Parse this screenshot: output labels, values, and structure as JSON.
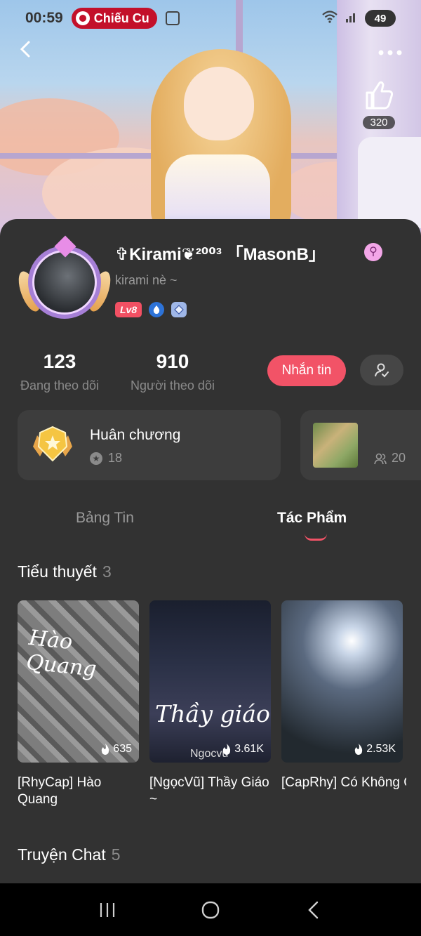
{
  "status_bar": {
    "time": "00:59",
    "live_label": "Chiếu Cu",
    "battery": "49"
  },
  "header": {
    "like_count": "320"
  },
  "profile": {
    "username": "✞Kirami❦²⁰⁰³ 「MasonB」",
    "bio": "kirami nè ~",
    "level": "Lv8",
    "gender_symbol": "⚲"
  },
  "stats": {
    "following_count": "123",
    "following_label": "Đang theo dõi",
    "followers_count": "910",
    "followers_label": "Người theo dõi"
  },
  "actions": {
    "message_label": "Nhắn tin"
  },
  "medals": {
    "title": "Huân chương",
    "count": "18"
  },
  "group": {
    "members": "20"
  },
  "tabs": [
    {
      "label": "Bảng Tin"
    },
    {
      "label": "Tác Phẩm"
    }
  ],
  "sections": {
    "novels": {
      "label": "Tiểu thuyết",
      "count": "3"
    },
    "chat_stories": {
      "label": "Truyện Chat",
      "count": "5"
    }
  },
  "novels": [
    {
      "title": "[RhyCap] Hào Quang",
      "views": "635",
      "cover_text": "Hào Quang"
    },
    {
      "title": "[NgọcVũ] Thầy Giáo ~",
      "views": "3.61K",
      "cover_text": "Thầy giáo",
      "cover_author": "Ngocvu"
    },
    {
      "title": "[CapRhy] Có Không Giữ... Mất Lại Tìm",
      "views": "2.53K"
    }
  ],
  "colors": {
    "accent": "#f25367",
    "card_bg": "#323232",
    "tile_bg": "#3d3d3d"
  }
}
